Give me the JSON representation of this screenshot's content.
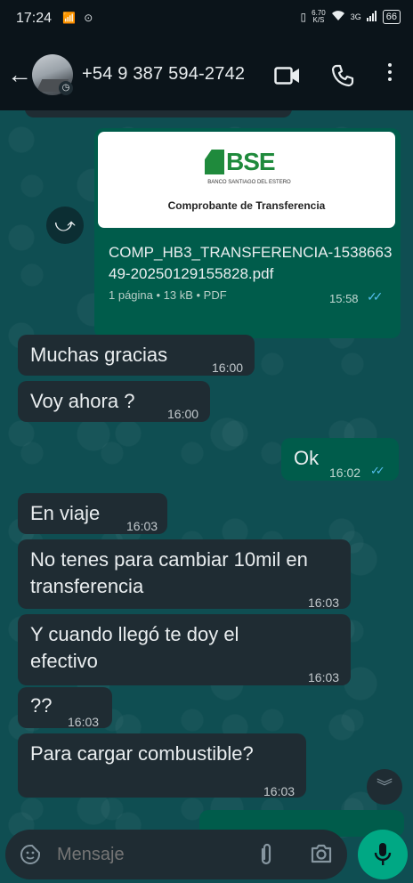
{
  "status_bar": {
    "time": "17:24",
    "left_icons": "📶 ⊙",
    "speed_value": "6.70",
    "speed_unit": "K/S",
    "network": "3G",
    "battery": "66"
  },
  "header": {
    "contact_name": "+54 9 387 594-2742"
  },
  "document": {
    "preview_title": "Comprobante de Transferencia",
    "logo_text": "BSE",
    "logo_subtitle": "BANCO SANTIAGO DEL ESTERO",
    "file_name": "COMP_HB3_TRANSFERENCIA-153866349-20250129155828.pdf",
    "meta": "1 página • 13 kB • PDF",
    "time": "15:58"
  },
  "messages": [
    {
      "id": "m1",
      "direction": "in",
      "text": "Muchas gracias",
      "time": "16:00"
    },
    {
      "id": "m2",
      "direction": "in",
      "text": "Voy ahora ?",
      "time": "16:00"
    },
    {
      "id": "m3",
      "direction": "out",
      "text": "Ok",
      "time": "16:02"
    },
    {
      "id": "m4",
      "direction": "in",
      "text": "En viaje",
      "time": "16:03"
    },
    {
      "id": "m5",
      "direction": "in",
      "text": "No tenes para cambiar 10mil en transferencia",
      "time": "16:03"
    },
    {
      "id": "m6",
      "direction": "in",
      "text": "Y cuando llegó te doy el efectivo",
      "time": "16:03"
    },
    {
      "id": "m7",
      "direction": "in",
      "text": "??",
      "time": "16:03"
    },
    {
      "id": "m8",
      "direction": "in",
      "text": "Para cargar combustible?",
      "time": "16:03"
    }
  ],
  "composer": {
    "placeholder": "Mensaje"
  },
  "colors": {
    "incoming_bubble": "#1f2c33",
    "outgoing_bubble": "#005c4b",
    "chat_background": "#0f4e52",
    "read_ticks": "#53bdeb",
    "mic_button": "#00a884"
  }
}
